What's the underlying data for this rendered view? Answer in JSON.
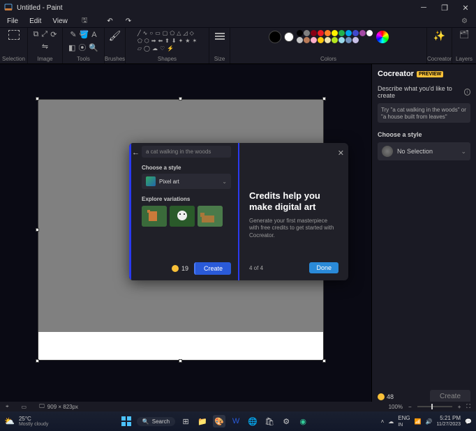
{
  "title": "Untitled - Paint",
  "menu": {
    "file": "File",
    "edit": "Edit",
    "view": "View"
  },
  "ribbon": {
    "selection": "Selection",
    "image": "Image",
    "tools": "Tools",
    "brushes": "Brushes",
    "shapes": "Shapes",
    "size": "Size",
    "colors": "Colors",
    "cocreator": "Cocreator",
    "layers": "Layers"
  },
  "palette_colors": [
    "#000",
    "#7f7f7f",
    "#880015",
    "#ed1c24",
    "#ff7f27",
    "#fff200",
    "#22b14c",
    "#00a2e8",
    "#3f48cc",
    "#a349a4",
    "#fff",
    "#c3c3c3",
    "#b97a57",
    "#ffaec9",
    "#ffc90e",
    "#efe4b0",
    "#b5e61d",
    "#99d9ea",
    "#7092be",
    "#c8bfe7"
  ],
  "canvas": {
    "dims": "909 × 823px"
  },
  "cocreator_panel": {
    "title": "Cocreator",
    "badge": "PREVIEW",
    "describe": "Describe what you'd like to create",
    "placeholder": "Try \"a cat walking in the woods\" or \"a house built from leaves\"",
    "choose_style": "Choose a style",
    "no_selection": "No Selection",
    "credits": "48",
    "create": "Create"
  },
  "modal": {
    "prompt": "a cat walking in the woods",
    "choose_style": "Choose a style",
    "style_selected": "Pixel art",
    "explore": "Explore variations",
    "credits": "19",
    "create": "Create",
    "right_title": "Credits help you make digital art",
    "right_desc": "Generate your first masterpiece with free credits to get started with Cocreator.",
    "step": "4 of 4",
    "done": "Done"
  },
  "statusbar": {
    "zoom": "100%"
  },
  "taskbar": {
    "temp": "25°C",
    "weather": "Mostly cloudy",
    "search": "Search",
    "lang": "ENG",
    "kb": "IN",
    "time": "5:21 PM",
    "date": "11/27/2023"
  }
}
